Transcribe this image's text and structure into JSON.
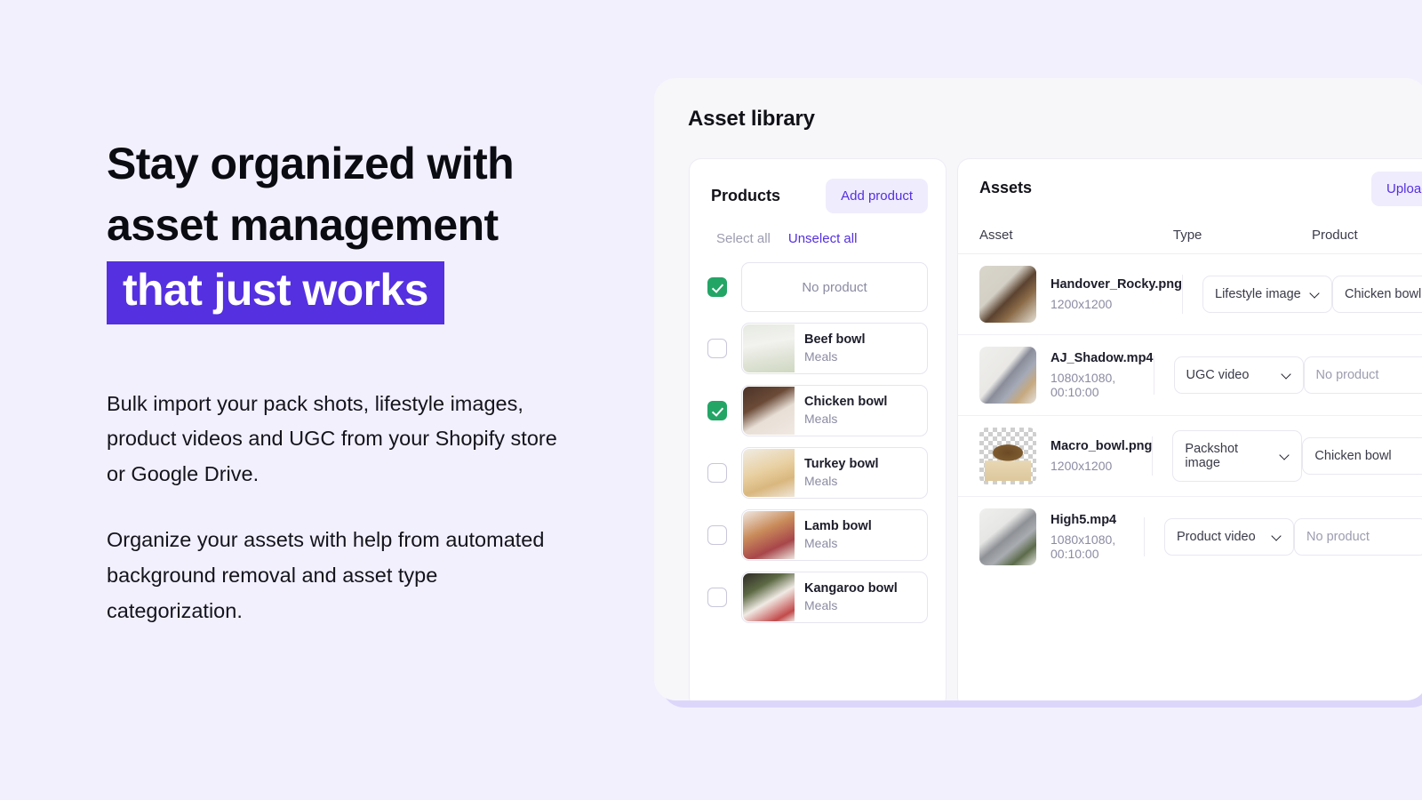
{
  "marketing": {
    "headline_line1": "Stay organized with",
    "headline_line2": "asset management",
    "headline_highlight": "that just works",
    "paragraph1": "Bulk import your pack shots, lifestyle images, product videos and UGC from your Shopify store or Google Drive.",
    "paragraph2": "Organize your assets with help from automated background removal and asset type categorization."
  },
  "colors": {
    "page_background": "#f2f0fd",
    "highlight_purple": "#5430e0",
    "accent_link": "#5430e0",
    "checkbox_green": "#23a566",
    "panel_background": "#f7f7fa",
    "panel_shadow": "#ddd6fb"
  },
  "app": {
    "title": "Asset library",
    "products_panel": {
      "title": "Products",
      "add_product_label": "Add product",
      "select_all_label": "Select all",
      "unselect_all_label": "Unselect all",
      "items": [
        {
          "name": "No product",
          "category": "",
          "checked": true,
          "empty": true
        },
        {
          "name": "Beef bowl",
          "category": "Meals",
          "checked": false,
          "empty": false
        },
        {
          "name": "Chicken bowl",
          "category": "Meals",
          "checked": true,
          "empty": false
        },
        {
          "name": "Turkey bowl",
          "category": "Meals",
          "checked": false,
          "empty": false
        },
        {
          "name": "Lamb bowl",
          "category": "Meals",
          "checked": false,
          "empty": false
        },
        {
          "name": "Kangaroo bowl",
          "category": "Meals",
          "checked": false,
          "empty": false
        }
      ]
    },
    "assets_panel": {
      "title": "Assets",
      "upload_label": "Upload",
      "columns": {
        "asset": "Asset",
        "type": "Type",
        "product": "Product"
      },
      "rows": [
        {
          "filename": "Handover_Rocky.png",
          "meta": "1200x1200",
          "type": "Lifestyle image",
          "product": "Chicken bowl",
          "product_muted": false,
          "transparent": false
        },
        {
          "filename": "AJ_Shadow.mp4",
          "meta": "1080x1080, 00:10:00",
          "type": "UGC video",
          "product": "No product",
          "product_muted": true,
          "transparent": false
        },
        {
          "filename": "Macro_bowl.png",
          "meta": "1200x1200",
          "type": "Packshot image",
          "product": "Chicken bowl",
          "product_muted": false,
          "transparent": true
        },
        {
          "filename": "High5.mp4",
          "meta": "1080x1080, 00:10:00",
          "type": "Product video",
          "product": "No product",
          "product_muted": true,
          "transparent": false
        }
      ]
    }
  }
}
